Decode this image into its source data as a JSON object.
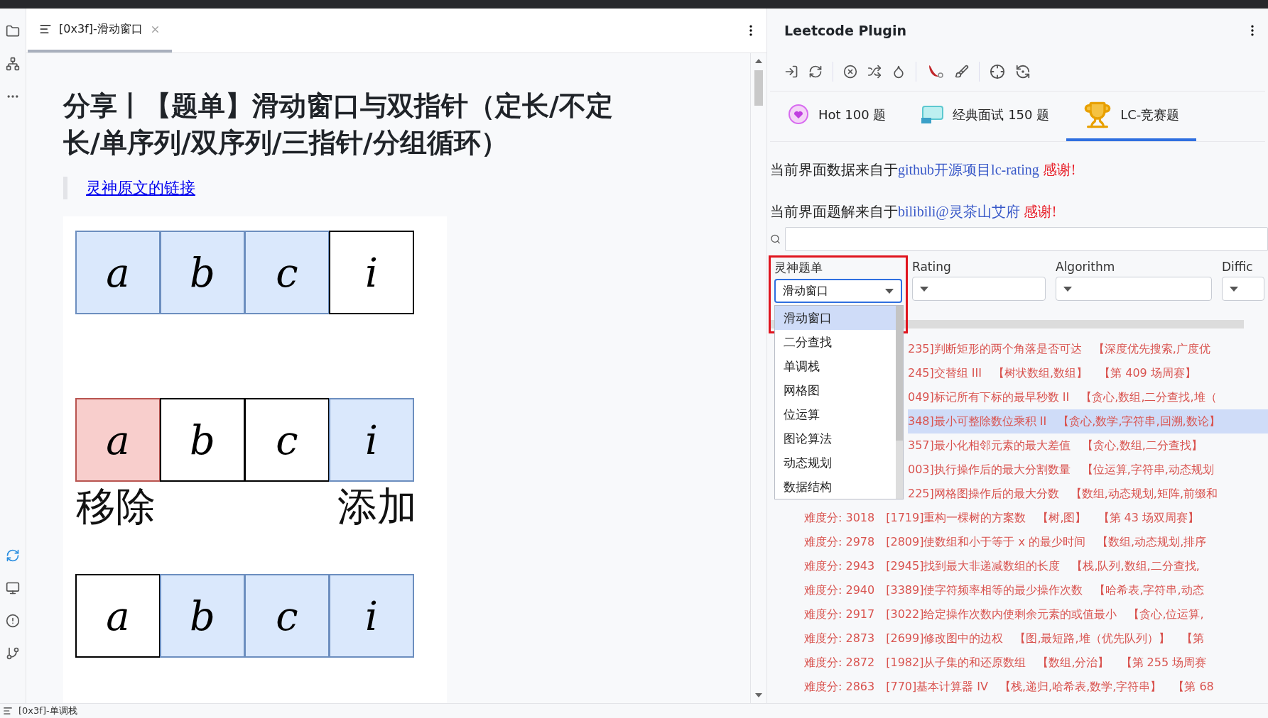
{
  "editor": {
    "tab": {
      "label": "[0x3f]-滑动窗口",
      "selected": true
    },
    "heading": "分享丨【题单】滑动窗口与双指针（定长/不定长/单序列/双序列/三指针/分组循环）",
    "quote_link": "灵神原文的链接",
    "diagram": [
      {
        "cells": [
          {
            "letter": "a",
            "color": "#dae8fc"
          },
          {
            "letter": "b",
            "color": "#dae8fc"
          },
          {
            "letter": "c",
            "color": "#dae8fc"
          },
          {
            "letter": "i",
            "color": "#ffffff"
          }
        ]
      },
      {
        "cells": [
          {
            "letter": "a",
            "color": "#f8cecc"
          },
          {
            "letter": "b",
            "color": "#ffffff"
          },
          {
            "letter": "c",
            "color": "#ffffff"
          },
          {
            "letter": "i",
            "color": "#dae8fc"
          }
        ],
        "left_label": "移除",
        "right_label": "添加"
      },
      {
        "cells": [
          {
            "letter": "a",
            "color": "#ffffff"
          },
          {
            "letter": "b",
            "color": "#dae8fc"
          },
          {
            "letter": "c",
            "color": "#dae8fc"
          },
          {
            "letter": "i",
            "color": "#dae8fc"
          }
        ]
      }
    ],
    "next_tab": "[0x3f]-单调栈"
  },
  "plugin": {
    "title": "Leetcode Plugin",
    "tabs": [
      {
        "label": "Hot 100 题",
        "selected": false
      },
      {
        "label": "经典面试 150 题",
        "selected": false
      },
      {
        "label": "LC-竞赛题",
        "selected": true
      }
    ],
    "credits": [
      {
        "text": "当前界面数据来自于",
        "link": "github开源项目lc-rating",
        "thanks": " 感谢!"
      },
      {
        "text": "当前界面题解来自于",
        "link": "bilibili@灵茶山艾府",
        "thanks": " 感谢!"
      }
    ],
    "filters": [
      {
        "label": "灵神题单",
        "value": "滑动窗口",
        "open": true
      },
      {
        "label": "Rating",
        "open": false
      },
      {
        "label": "Algorithm",
        "open": false
      },
      {
        "label": "Diffic",
        "open": false
      }
    ],
    "options": [
      {
        "label": "滑动窗口",
        "selected": true
      },
      {
        "label": "二分查找",
        "selected": false
      },
      {
        "label": "单调栈",
        "selected": false
      },
      {
        "label": "网格图",
        "selected": false
      },
      {
        "label": "位运算",
        "selected": false
      },
      {
        "label": "图论算法",
        "selected": false
      },
      {
        "label": "动态规划",
        "selected": false
      },
      {
        "label": "数据结构",
        "selected": false
      }
    ],
    "rows": [
      {
        "title": "235]判断矩形的两个角落是否可达",
        "tags": [
          "【深度优先搜索,广度优"
        ],
        "selected": false
      },
      {
        "title": "245]交替组 III",
        "tags": [
          "【树状数组,数组】",
          "【第 409 场周赛】"
        ],
        "selected": false
      },
      {
        "title": "049]标记所有下标的最早秒数 II",
        "tags": [
          "【贪心,数组,二分查找,堆（"
        ],
        "selected": false
      },
      {
        "title": "348]最小可整除数位乘积 II",
        "tags": [
          "【贪心,数学,字符串,回溯,数论】"
        ],
        "selected": true
      },
      {
        "title": "357]最小化相邻元素的最大差值",
        "tags": [
          "【贪心,数组,二分查找】"
        ],
        "selected": false
      },
      {
        "title": "003]执行操作后的最大分割数量",
        "tags": [
          "【位运算,字符串,动态规划"
        ],
        "selected": false
      },
      {
        "title": "225]网格图操作后的最大分数",
        "tags": [
          "【数组,动态规划,矩阵,前缀和"
        ],
        "selected": false
      },
      {
        "rating": "难度分: 3018",
        "title": "[1719]重构一棵树的方案数",
        "tags": [
          "【树,图】",
          "【第 43 场双周赛】"
        ],
        "selected": false
      },
      {
        "rating": "难度分: 2978",
        "title": "[2809]使数组和小于等于 x 的最少时间",
        "tags": [
          "【数组,动态规划,排序"
        ],
        "selected": false
      },
      {
        "rating": "难度分: 2943",
        "title": "[2945]找到最大非递减数组的长度",
        "tags": [
          "【栈,队列,数组,二分查找,"
        ],
        "selected": false
      },
      {
        "rating": "难度分: 2940",
        "title": "[3389]使字符频率相等的最少操作次数",
        "tags": [
          "【哈希表,字符串,动态"
        ],
        "selected": false
      },
      {
        "rating": "难度分: 2917",
        "title": "[3022]给定操作次数内使剩余元素的或值最小",
        "tags": [
          "【贪心,位运算,"
        ],
        "selected": false
      },
      {
        "rating": "难度分: 2873",
        "title": "[2699]修改图中的边权",
        "tags": [
          "【图,最短路,堆（优先队列）】",
          "【第"
        ],
        "selected": false
      },
      {
        "rating": "难度分: 2872",
        "title": "[1982]从子集的和还原数组",
        "tags": [
          "【数组,分治】",
          "【第 255 场周赛"
        ],
        "selected": false
      },
      {
        "rating": "难度分: 2863",
        "title": "[770]基本计算器 IV",
        "tags": [
          "【栈,递归,哈希表,数学,字符串】",
          "【第 68"
        ],
        "selected": false
      }
    ]
  }
}
